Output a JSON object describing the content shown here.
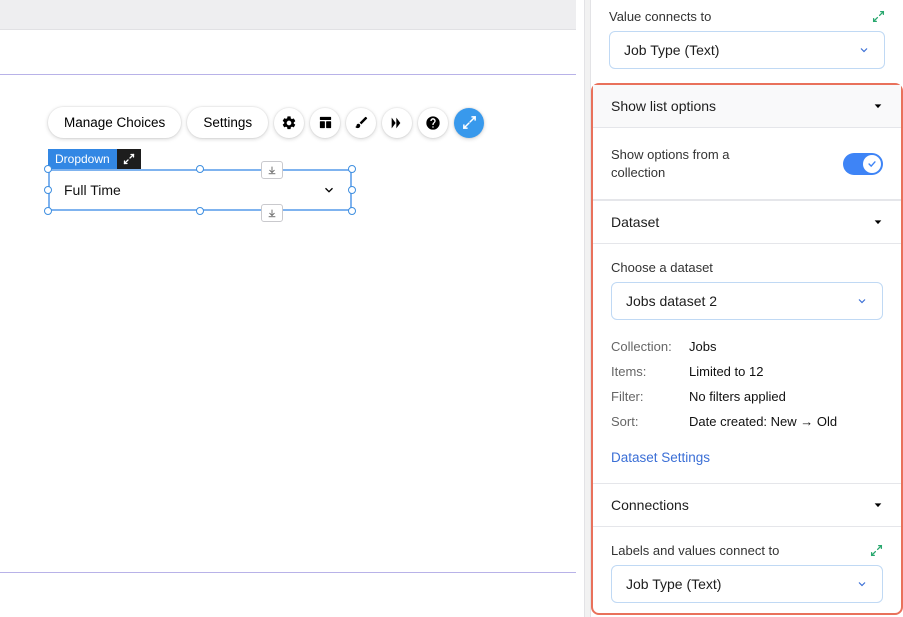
{
  "canvas": {
    "toolbar": {
      "manage_choices": "Manage Choices",
      "settings": "Settings"
    },
    "element_tag": "Dropdown",
    "dropdown_value": "Full Time"
  },
  "panel": {
    "value_connects_label": "Value connects to",
    "value_connects_value": "Job Type (Text)",
    "show_list_options": {
      "header": "Show list options",
      "toggle_label": "Show options from a collection",
      "toggle_on": true
    },
    "dataset": {
      "header": "Dataset",
      "choose_label": "Choose a dataset",
      "selected": "Jobs dataset 2",
      "rows": {
        "collection_key": "Collection:",
        "collection_val": "Jobs",
        "items_key": "Items:",
        "items_val": "Limited to 12",
        "filter_key": "Filter:",
        "filter_val": "No filters applied",
        "sort_key": "Sort:",
        "sort_val": "Date created: New → Old"
      },
      "settings_link": "Dataset Settings"
    },
    "connections": {
      "header": "Connections",
      "labels_values_label": "Labels and values connect to",
      "labels_values_value": "Job Type (Text)"
    }
  }
}
